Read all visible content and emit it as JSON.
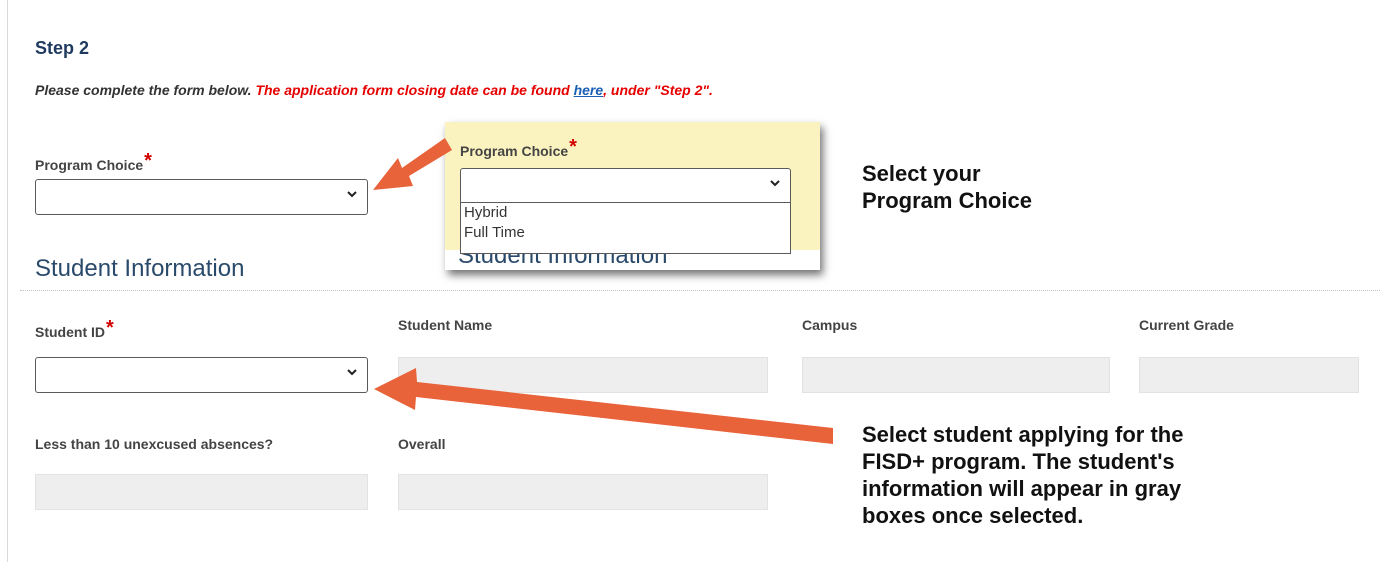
{
  "step": {
    "title": "Step 2"
  },
  "instructions": {
    "plain": "Please complete the form below. ",
    "red_before_link": "The application form closing date can be found ",
    "link": "here",
    "red_after_link": ", under \"Step 2\"."
  },
  "program_choice": {
    "label": "Program Choice",
    "required_mark": "*",
    "value": ""
  },
  "section": {
    "title": "Student Information"
  },
  "fields": {
    "student_id": {
      "label": "Student ID",
      "required_mark": "*",
      "value": ""
    },
    "student_name": {
      "label": "Student Name",
      "value": ""
    },
    "campus": {
      "label": "Campus",
      "value": ""
    },
    "current_grade": {
      "label": "Current Grade",
      "value": ""
    },
    "absences": {
      "label": "Less than 10 unexcused absences?",
      "value": ""
    },
    "overall": {
      "label": "Overall",
      "value": ""
    }
  },
  "popup": {
    "label": "Program Choice",
    "required_mark": "*",
    "options": [
      "Hybrid",
      "Full Time"
    ],
    "background_title": "Student Information"
  },
  "callouts": {
    "program": [
      "Select your",
      "Program Choice"
    ],
    "student": [
      "Select student applying for the",
      "FISD+ program.  The student's",
      "information will appear in gray",
      "boxes once selected."
    ]
  },
  "colors": {
    "arrow": "#e8623a",
    "required": "#d40000",
    "link": "#1a5fb4",
    "highlight": "#fbf3bf",
    "readonly_fill": "#eeeeee"
  },
  "icons": {
    "dropdown": "chevron-down-icon",
    "annotation": "arrow-icon"
  }
}
